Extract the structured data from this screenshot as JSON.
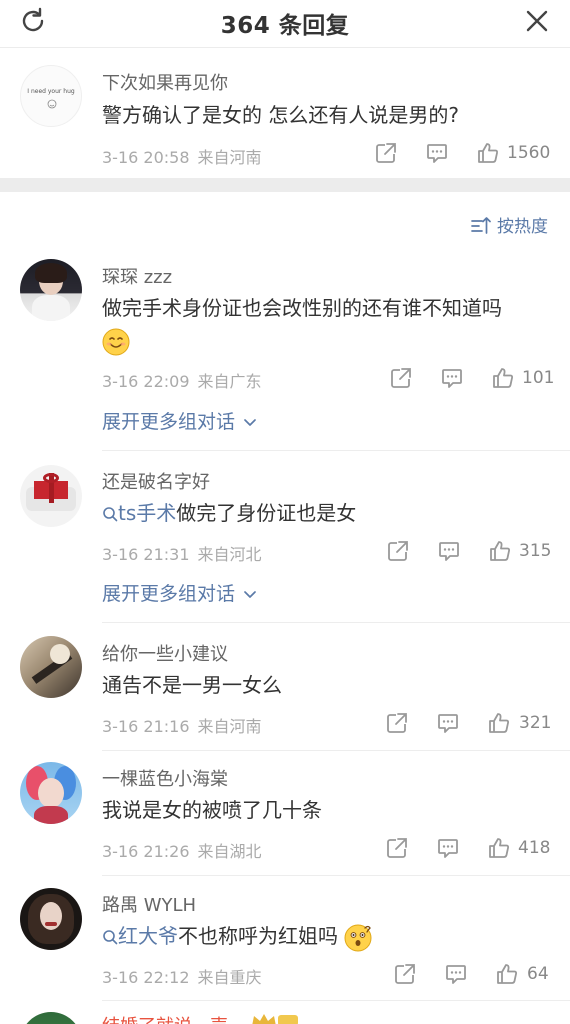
{
  "header": {
    "title": "364 条回复",
    "refresh_icon": "refresh-icon",
    "close_icon": "close-icon"
  },
  "original": {
    "username": "下次如果再见你",
    "avatar_text": "I need your hug",
    "text": "警方确认了是女的 怎么还有人说是男的?",
    "date": "3-16 20:58",
    "location": "来自河南",
    "likes": "1560"
  },
  "sort": {
    "label": "按热度"
  },
  "comments": [
    {
      "username": "琛琛 zzz",
      "text": "做完手术身份证也会改性别的还有谁不知道吗",
      "emoji": "smile",
      "date": "3-16 22:09",
      "location": "来自广东",
      "likes": "101",
      "expand": "展开更多组对话"
    },
    {
      "username": "还是破名字好",
      "topic": "ts手术",
      "text": "做完了身份证也是女",
      "date": "3-16 21:31",
      "location": "来自河北",
      "likes": "315",
      "expand": "展开更多组对话"
    },
    {
      "username": "给你一些小建议",
      "text": "通告不是一男一女么",
      "date": "3-16 21:16",
      "location": "来自河南",
      "likes": "321"
    },
    {
      "username": "一棵蓝色小海棠",
      "text": "我说是女的被喷了几十条",
      "date": "3-16 21:26",
      "location": "来自湖北",
      "likes": "418"
    },
    {
      "username": "路禺 WYLH",
      "topic": "红大爷",
      "text": "不也称呼为红姐吗",
      "emoji": "thinking",
      "date": "3-16 22:12",
      "location": "来自重庆",
      "likes": "64"
    }
  ],
  "partial": {
    "username": "结婚了就说一声"
  },
  "colors": {
    "link": "#5b7aa8",
    "meta": "#aaaaaa",
    "band": "#ececec",
    "partial_name": "#e8533f"
  }
}
